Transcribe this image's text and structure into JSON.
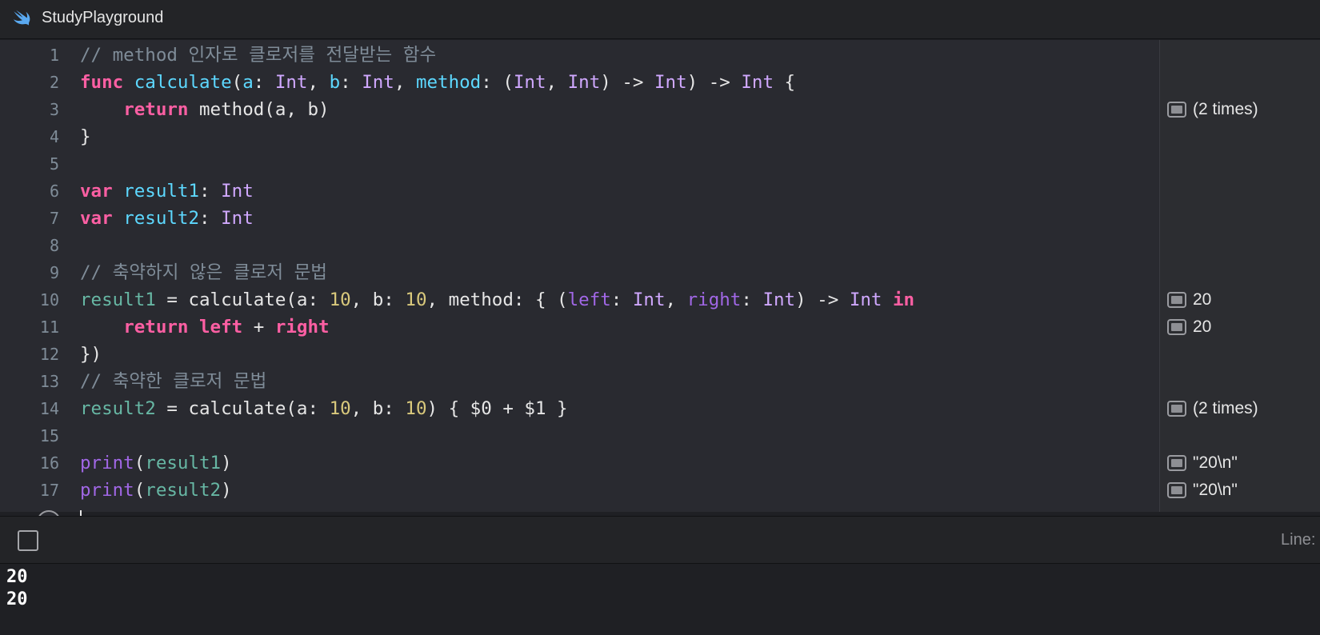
{
  "window": {
    "title": "StudyPlayground",
    "icon": "swift-icon"
  },
  "editor": {
    "lines": [
      {
        "n": "1",
        "tokens": [
          {
            "t": "// method 인자로 클로저를 전달받는 함수",
            "c": "cm"
          }
        ]
      },
      {
        "n": "2",
        "tokens": [
          {
            "t": "func",
            "c": "kw"
          },
          {
            "t": " ",
            "c": "plain"
          },
          {
            "t": "calculate",
            "c": "fn"
          },
          {
            "t": "(",
            "c": "plain"
          },
          {
            "t": "a",
            "c": "fn"
          },
          {
            "t": ": ",
            "c": "plain"
          },
          {
            "t": "Int",
            "c": "type"
          },
          {
            "t": ", ",
            "c": "plain"
          },
          {
            "t": "b",
            "c": "fn"
          },
          {
            "t": ": ",
            "c": "plain"
          },
          {
            "t": "Int",
            "c": "type"
          },
          {
            "t": ", ",
            "c": "plain"
          },
          {
            "t": "method",
            "c": "fn"
          },
          {
            "t": ": (",
            "c": "plain"
          },
          {
            "t": "Int",
            "c": "type"
          },
          {
            "t": ", ",
            "c": "plain"
          },
          {
            "t": "Int",
            "c": "type"
          },
          {
            "t": ") -> ",
            "c": "plain"
          },
          {
            "t": "Int",
            "c": "type"
          },
          {
            "t": ") -> ",
            "c": "plain"
          },
          {
            "t": "Int",
            "c": "type"
          },
          {
            "t": " {",
            "c": "plain"
          }
        ]
      },
      {
        "n": "3",
        "tokens": [
          {
            "t": "    ",
            "c": "plain"
          },
          {
            "t": "return",
            "c": "kw"
          },
          {
            "t": " method(a, b)",
            "c": "plain"
          }
        ]
      },
      {
        "n": "4",
        "tokens": [
          {
            "t": "}",
            "c": "plain"
          }
        ]
      },
      {
        "n": "5",
        "tokens": []
      },
      {
        "n": "6",
        "tokens": [
          {
            "t": "var",
            "c": "kw"
          },
          {
            "t": " ",
            "c": "plain"
          },
          {
            "t": "result1",
            "c": "fn"
          },
          {
            "t": ": ",
            "c": "plain"
          },
          {
            "t": "Int",
            "c": "type"
          }
        ]
      },
      {
        "n": "7",
        "tokens": [
          {
            "t": "var",
            "c": "kw"
          },
          {
            "t": " ",
            "c": "plain"
          },
          {
            "t": "result2",
            "c": "fn"
          },
          {
            "t": ": ",
            "c": "plain"
          },
          {
            "t": "Int",
            "c": "type"
          }
        ]
      },
      {
        "n": "8",
        "tokens": []
      },
      {
        "n": "9",
        "tokens": [
          {
            "t": "// 축약하지 않은 클로저 문법",
            "c": "cm"
          }
        ]
      },
      {
        "n": "10",
        "tokens": [
          {
            "t": "result1",
            "c": "var"
          },
          {
            "t": " = calculate(a: ",
            "c": "plain"
          },
          {
            "t": "10",
            "c": "num"
          },
          {
            "t": ", b: ",
            "c": "plain"
          },
          {
            "t": "10",
            "c": "num"
          },
          {
            "t": ", method: { (",
            "c": "plain"
          },
          {
            "t": "left",
            "c": "param"
          },
          {
            "t": ": ",
            "c": "plain"
          },
          {
            "t": "Int",
            "c": "type"
          },
          {
            "t": ", ",
            "c": "plain"
          },
          {
            "t": "right",
            "c": "param"
          },
          {
            "t": ": ",
            "c": "plain"
          },
          {
            "t": "Int",
            "c": "type"
          },
          {
            "t": ") -> ",
            "c": "plain"
          },
          {
            "t": "Int",
            "c": "type"
          },
          {
            "t": " ",
            "c": "plain"
          },
          {
            "t": "in",
            "c": "kw"
          }
        ]
      },
      {
        "n": "11",
        "tokens": [
          {
            "t": "    ",
            "c": "plain"
          },
          {
            "t": "return",
            "c": "kw"
          },
          {
            "t": " ",
            "c": "plain"
          },
          {
            "t": "left",
            "c": "kw"
          },
          {
            "t": " + ",
            "c": "plain"
          },
          {
            "t": "right",
            "c": "kw"
          }
        ]
      },
      {
        "n": "12",
        "tokens": [
          {
            "t": "})",
            "c": "plain"
          }
        ]
      },
      {
        "n": "13",
        "tokens": [
          {
            "t": "// 축약한 클로저 문법",
            "c": "cm"
          }
        ]
      },
      {
        "n": "14",
        "tokens": [
          {
            "t": "result2",
            "c": "var"
          },
          {
            "t": " = calculate(a: ",
            "c": "plain"
          },
          {
            "t": "10",
            "c": "num"
          },
          {
            "t": ", b: ",
            "c": "plain"
          },
          {
            "t": "10",
            "c": "num"
          },
          {
            "t": ") { $0 + $1 }",
            "c": "plain"
          }
        ]
      },
      {
        "n": "15",
        "tokens": []
      },
      {
        "n": "16",
        "tokens": [
          {
            "t": "print",
            "c": "param"
          },
          {
            "t": "(",
            "c": "plain"
          },
          {
            "t": "result1",
            "c": "var"
          },
          {
            "t": ")",
            "c": "plain"
          }
        ]
      },
      {
        "n": "17",
        "tokens": [
          {
            "t": "print",
            "c": "param"
          },
          {
            "t": "(",
            "c": "plain"
          },
          {
            "t": "result2",
            "c": "var"
          },
          {
            "t": ")",
            "c": "plain"
          }
        ]
      }
    ]
  },
  "results": [
    {
      "line": 3,
      "text": "(2 times)"
    },
    {
      "line": 10,
      "text": "20"
    },
    {
      "line": 11,
      "text": "20"
    },
    {
      "line": 14,
      "text": "(2 times)"
    },
    {
      "line": 16,
      "text": "\"20\\n\""
    },
    {
      "line": 17,
      "text": "\"20\\n\""
    }
  ],
  "debugbar": {
    "line_label": "Line:"
  },
  "console": {
    "output": [
      "20",
      "20"
    ]
  }
}
